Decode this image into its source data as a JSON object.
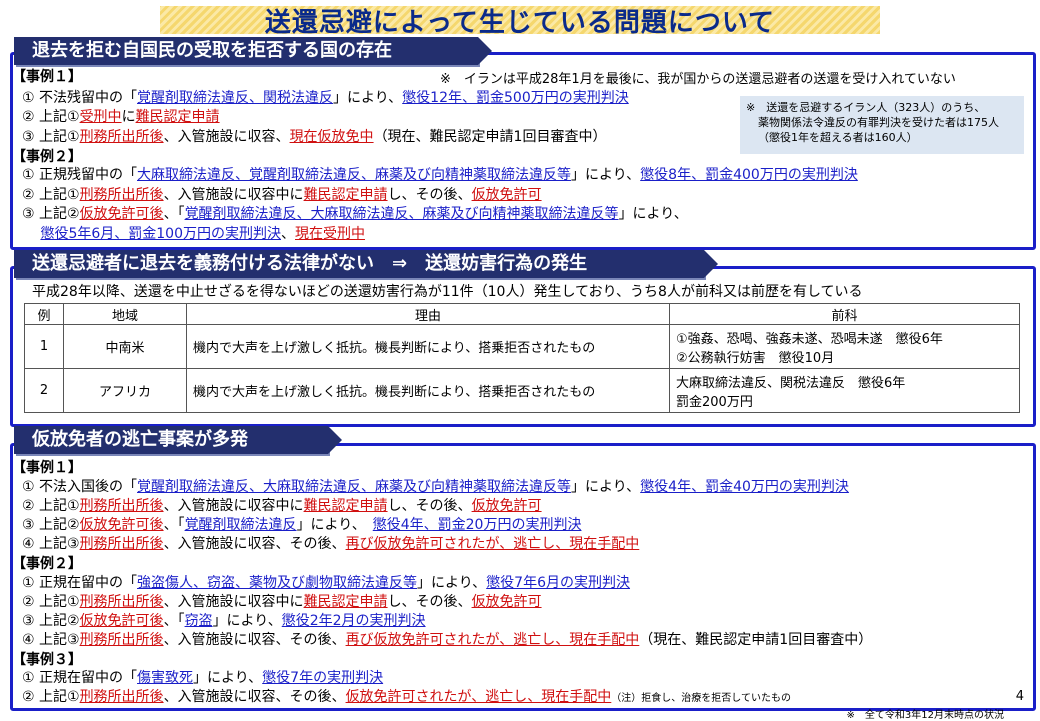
{
  "title": "送還忌避によって生じている問題について",
  "sections": [
    {
      "header": "退去を拒む自国民の受取を拒否する国の存在"
    },
    {
      "header": "送還忌避者に退去を義務付ける法律がない　⇒　送還妨害行為の発生"
    },
    {
      "header": "仮放免者の逃亡事案が多発"
    }
  ],
  "s1": {
    "note_iran": "※　イランは平成28年1月を最後に、我が国からの送還忌避者の送還を受け入れていない",
    "notebox": [
      "※　送還を忌避するイラン人（323人）のうち、",
      "薬物関係法令違反の有罪判決を受けた者は175人",
      "（懲役1年を超える者は160人）"
    ],
    "lines": [
      [
        {
          "t": "【事例１】",
          "c": "case"
        }
      ],
      [
        {
          "t": "① 不法残留中の「"
        },
        {
          "t": "覚醒剤取締法違反、関税法違反",
          "c": "u-blue"
        },
        {
          "t": "」により、"
        },
        {
          "t": "懲役12年、罰金500万円の実刑判決",
          "c": "u-blue"
        }
      ],
      [
        {
          "t": "② 上記①"
        },
        {
          "t": "受刑中",
          "c": "u-red"
        },
        {
          "t": "に"
        },
        {
          "t": "難民認定申請",
          "c": "u-red"
        }
      ],
      [
        {
          "t": "③ 上記①"
        },
        {
          "t": "刑務所出所後",
          "c": "u-red"
        },
        {
          "t": "、入管施設に収容、"
        },
        {
          "t": "現在仮放免中",
          "c": "u-red"
        },
        {
          "t": "（現在、難民認定申請1回目審査中）"
        }
      ],
      [
        {
          "t": "【事例２】",
          "c": "case"
        }
      ],
      [
        {
          "t": "① 正規残留中の「"
        },
        {
          "t": "大麻取締法違反、覚醒剤取締法違反、麻薬及び向精神薬取締法違反等",
          "c": "u-blue"
        },
        {
          "t": "」により、"
        },
        {
          "t": "懲役8年、罰金400万円の実刑判決",
          "c": "u-blue"
        }
      ],
      [
        {
          "t": "② 上記①"
        },
        {
          "t": "刑務所出所後",
          "c": "u-red"
        },
        {
          "t": "、入管施設に収容中に"
        },
        {
          "t": "難民認定申請",
          "c": "u-red"
        },
        {
          "t": "し、その後、"
        },
        {
          "t": "仮放免許可",
          "c": "u-red"
        }
      ],
      [
        {
          "t": "③ 上記②"
        },
        {
          "t": "仮放免許可後",
          "c": "u-red"
        },
        {
          "t": "、「"
        },
        {
          "t": "覚醒剤取締法違反、大麻取締法違反、麻薬及び向精神薬取締法違反等",
          "c": "u-blue"
        },
        {
          "t": "」により、"
        }
      ],
      [
        {
          "t": "　 "
        },
        {
          "t": "懲役5年6月、罰金100万円の実刑判決",
          "c": "u-blue"
        },
        {
          "t": "、"
        },
        {
          "t": "現在受刑中",
          "c": "u-red"
        }
      ]
    ]
  },
  "s2": {
    "intro": "平成28年以降、送還を中止せざるを得ないほどの送還妨害行為が11件（10人）発生しており、うち8人が前科又は前歴を有している",
    "table_headers": [
      "例",
      "地域",
      "理由",
      "前科"
    ],
    "rows": [
      {
        "no": "1",
        "region": "中南米",
        "reason": "機内で大声を上げ激しく抵抗。機長判断により、搭乗拒否されたもの",
        "record1": "①強姦、恐喝、強姦未遂、恐喝未遂　懲役6年",
        "record2": "②公務執行妨害　懲役10月"
      },
      {
        "no": "2",
        "region": "アフリカ",
        "reason": "機内で大声を上げ激しく抵抗。機長判断により、搭乗拒否されたもの",
        "record1": "大麻取締法違反、関税法違反　懲役6年",
        "record2": "罰金200万円"
      }
    ]
  },
  "s3": {
    "lines": [
      [
        {
          "t": "【事例１】",
          "c": "case"
        }
      ],
      [
        {
          "t": "① 不法入国後の「"
        },
        {
          "t": "覚醒剤取締法違反、大麻取締法違反、麻薬及び向精神薬取締法違反等",
          "c": "u-blue"
        },
        {
          "t": "」により、"
        },
        {
          "t": "懲役4年、罰金40万円の実刑判決",
          "c": "u-blue"
        }
      ],
      [
        {
          "t": "② 上記①"
        },
        {
          "t": "刑務所出所後",
          "c": "u-red"
        },
        {
          "t": "、入管施設に収容中に"
        },
        {
          "t": "難民認定申請",
          "c": "u-red"
        },
        {
          "t": "し、その後、"
        },
        {
          "t": "仮放免許可",
          "c": "u-red"
        }
      ],
      [
        {
          "t": "③ 上記②"
        },
        {
          "t": "仮放免許可後",
          "c": "u-red"
        },
        {
          "t": "、「"
        },
        {
          "t": "覚醒剤取締法違反",
          "c": "u-blue"
        },
        {
          "t": "」により、　"
        },
        {
          "t": "懲役4年、罰金20万円の実刑判決",
          "c": "u-blue"
        }
      ],
      [
        {
          "t": "④ 上記③"
        },
        {
          "t": "刑務所出所後",
          "c": "u-red"
        },
        {
          "t": "、入管施設に収容、その後、"
        },
        {
          "t": "再び仮放免許可されたが、逃亡し、現在手配中",
          "c": "u-red"
        }
      ],
      [
        {
          "t": "【事例２】",
          "c": "case"
        }
      ],
      [
        {
          "t": "① 正規在留中の「"
        },
        {
          "t": "強盗傷人、窃盗、薬物及び劇物取締法違反等",
          "c": "u-blue"
        },
        {
          "t": "」により、"
        },
        {
          "t": "懲役7年6月の実刑判決",
          "c": "u-blue"
        }
      ],
      [
        {
          "t": "② 上記①"
        },
        {
          "t": "刑務所出所後",
          "c": "u-red"
        },
        {
          "t": "、入管施設に収容中に"
        },
        {
          "t": "難民認定申請",
          "c": "u-red"
        },
        {
          "t": "し、その後、"
        },
        {
          "t": "仮放免許可",
          "c": "u-red"
        }
      ],
      [
        {
          "t": "③ 上記②"
        },
        {
          "t": "仮放免許可後",
          "c": "u-red"
        },
        {
          "t": "、「"
        },
        {
          "t": "窃盗",
          "c": "u-blue"
        },
        {
          "t": "」により、"
        },
        {
          "t": "懲役2年2月の実刑判決",
          "c": "u-blue"
        }
      ],
      [
        {
          "t": "④ 上記③"
        },
        {
          "t": "刑務所出所後",
          "c": "u-red"
        },
        {
          "t": "、入管施設に収容、その後、"
        },
        {
          "t": "再び仮放免許可されたが、逃亡し、現在手配中",
          "c": "u-red"
        },
        {
          "t": "（現在、難民認定申請1回目審査中）"
        }
      ],
      [
        {
          "t": "【事例３】",
          "c": "case"
        }
      ],
      [
        {
          "t": "① 正規在留中の「"
        },
        {
          "t": "傷害致死",
          "c": "u-blue"
        },
        {
          "t": "」により、"
        },
        {
          "t": "懲役7年の実刑判決",
          "c": "u-blue"
        }
      ],
      [
        {
          "t": "② 上記①"
        },
        {
          "t": "刑務所出所後",
          "c": "u-red"
        },
        {
          "t": "、入管施設に収容、その後、"
        },
        {
          "t": "仮放免許可されたが、逃亡し、現在手配中",
          "c": "u-red"
        },
        {
          "t": "（注）拒食し、治療を拒否していたもの",
          "c": "small-note"
        }
      ]
    ]
  },
  "page_number": "4",
  "footnote": "※　全て令和3年12月末時点の状況"
}
